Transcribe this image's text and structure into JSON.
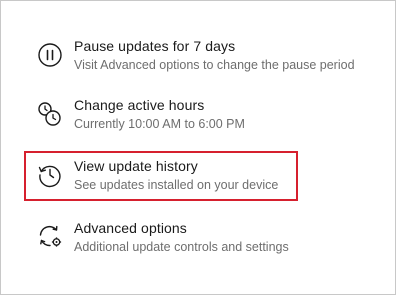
{
  "options": [
    {
      "title": "Pause updates for 7 days",
      "description": "Visit Advanced options to change the pause period",
      "icon": "pause-circle-icon"
    },
    {
      "title": "Change active hours",
      "description": "Currently 10:00 AM to 6:00 PM",
      "icon": "clock-schedule-icon"
    },
    {
      "title": "View update history",
      "description": "See updates installed on your device",
      "icon": "history-icon"
    },
    {
      "title": "Advanced options",
      "description": "Additional update controls and settings",
      "icon": "sync-gear-icon"
    }
  ],
  "highlight": {
    "target": "View update history",
    "color": "#d6202e"
  },
  "colors": {
    "title_text": "#1a1a1a",
    "description_text": "#6e6e6e",
    "border": "#c8c8c8"
  }
}
